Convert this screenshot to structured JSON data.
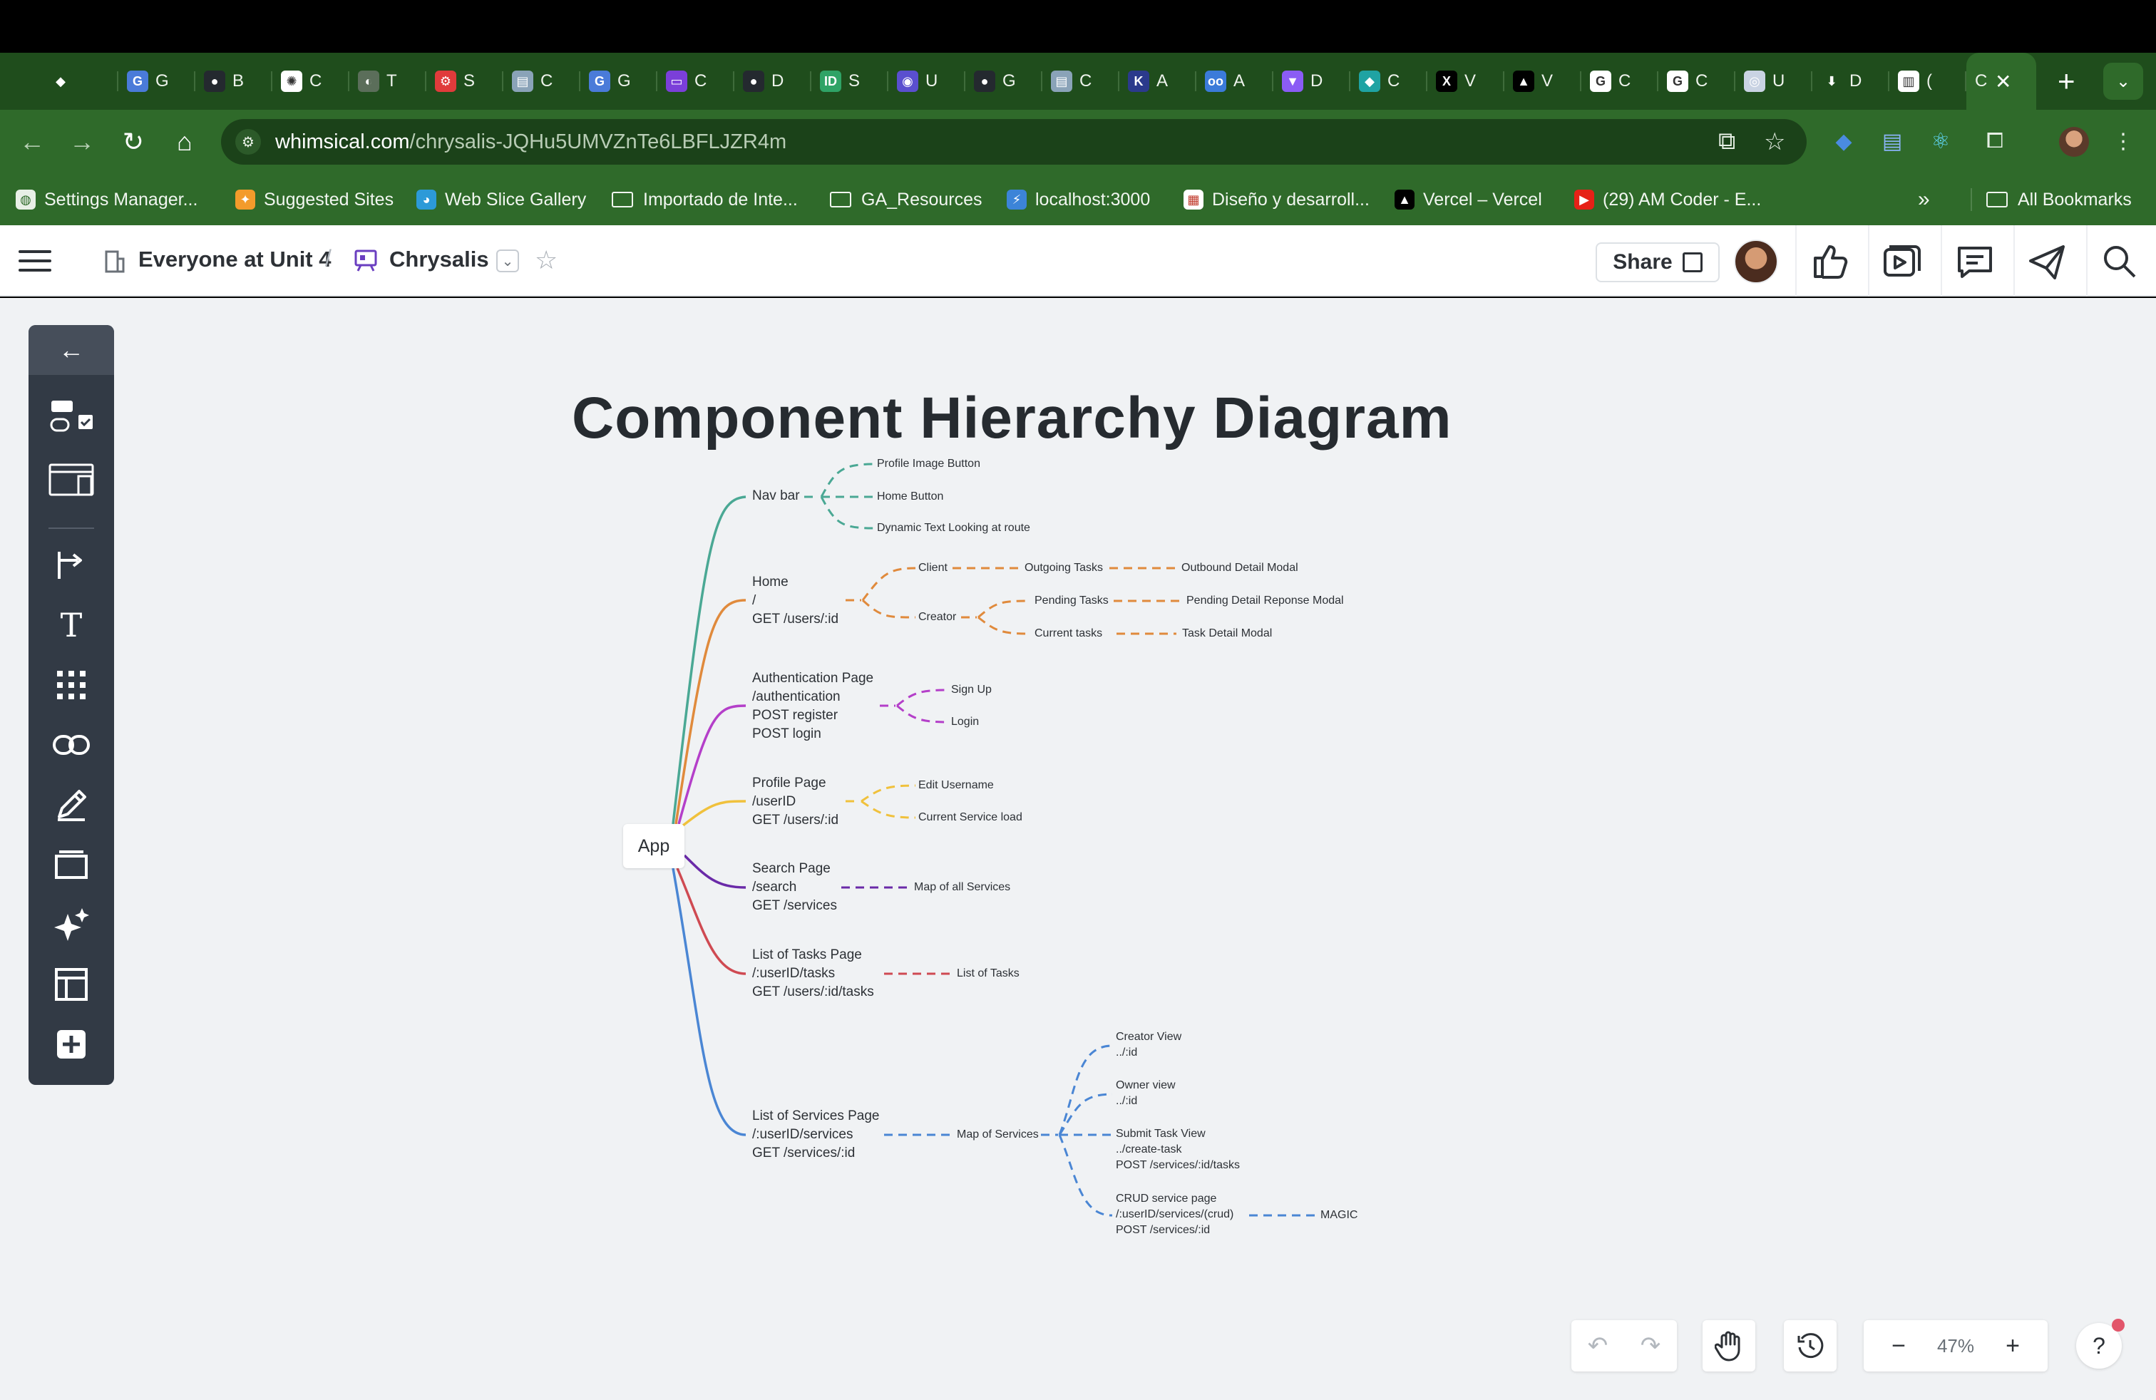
{
  "browser": {
    "tabs": [
      {
        "title": "",
        "fav_color": "#1f4d1c",
        "fav_glyph": "◆"
      },
      {
        "title": "G",
        "fav_color": "#4a7bd9",
        "fav_glyph": "G"
      },
      {
        "title": "B",
        "fav_color": "#24292f",
        "fav_glyph": "●"
      },
      {
        "title": "C",
        "fav_color": "#ffffff",
        "fav_glyph": "✺"
      },
      {
        "title": "T",
        "fav_color": "#5b6e5a",
        "fav_glyph": "◐"
      },
      {
        "title": "S",
        "fav_color": "#e03b3b",
        "fav_glyph": "⚙"
      },
      {
        "title": "C",
        "fav_color": "#8aa3b8",
        "fav_glyph": "▤"
      },
      {
        "title": "G",
        "fav_color": "#4a7bd9",
        "fav_glyph": "G"
      },
      {
        "title": "C",
        "fav_color": "#7b3fd9",
        "fav_glyph": "▭"
      },
      {
        "title": "D",
        "fav_color": "#24292f",
        "fav_glyph": "●"
      },
      {
        "title": "S",
        "fav_color": "#2fa366",
        "fav_glyph": "ID"
      },
      {
        "title": "U",
        "fav_color": "#5a4fcf",
        "fav_glyph": "◉"
      },
      {
        "title": "G",
        "fav_color": "#24292f",
        "fav_glyph": "●"
      },
      {
        "title": "C",
        "fav_color": "#8aa3b8",
        "fav_glyph": "▤"
      },
      {
        "title": "A",
        "fav_color": "#2b3a8c",
        "fav_glyph": "K"
      },
      {
        "title": "A",
        "fav_color": "#3b7bd9",
        "fav_glyph": "oo"
      },
      {
        "title": "D",
        "fav_color": "#8a5cf5",
        "fav_glyph": "▼"
      },
      {
        "title": "C",
        "fav_color": "#1fa3a3",
        "fav_glyph": "◆"
      },
      {
        "title": "V",
        "fav_color": "#000000",
        "fav_glyph": "X"
      },
      {
        "title": "V",
        "fav_color": "#000000",
        "fav_glyph": "▲"
      },
      {
        "title": "C",
        "fav_color": "#ffffff",
        "fav_glyph": "G"
      },
      {
        "title": "C",
        "fav_color": "#ffffff",
        "fav_glyph": "G"
      },
      {
        "title": "U",
        "fav_color": "#c9d3e3",
        "fav_glyph": "◎"
      },
      {
        "title": "D",
        "fav_color": "#1f4d1c",
        "fav_glyph": "⬇"
      },
      {
        "title": "(",
        "fav_color": "#ffffff",
        "fav_glyph": "▥"
      }
    ],
    "active_tab_title": "C",
    "address": {
      "host": "whimsical.com",
      "path": "/chrysalis-JQHu5UMVZnTe6LBFLJZR4m"
    },
    "bookmarks": [
      {
        "label": "Settings Manager...",
        "icon": "globe-icon"
      },
      {
        "label": "Suggested Sites",
        "icon": "bulb-icon"
      },
      {
        "label": "Web Slice Gallery",
        "icon": "edge-icon"
      },
      {
        "label": "Importado de Inte...",
        "icon": "folder-icon"
      },
      {
        "label": "GA_Resources",
        "icon": "folder-icon"
      },
      {
        "label": "localhost:3000",
        "icon": "lightning-icon"
      },
      {
        "label": "Diseño y desarroll...",
        "icon": "site-icon"
      },
      {
        "label": "Vercel – Vercel",
        "icon": "vercel-icon"
      },
      {
        "label": "(29) AM Coder - E...",
        "icon": "youtube-icon"
      }
    ],
    "overflow_label": "»",
    "all_bookmarks_label": "All Bookmarks"
  },
  "app_header": {
    "workspace": "Everyone at Unit 4",
    "separator": "/",
    "board": "Chrysalis",
    "share_label": "Share"
  },
  "diagram": {
    "title": "Component Hierarchy Diagram",
    "root": "App",
    "colors": {
      "nav": "#4aa894",
      "home": "#e08a3c",
      "auth": "#b43fc9",
      "profile": "#f0c13c",
      "search": "#6a2aa8",
      "tasks": "#cf4a52",
      "services": "#4a86d4"
    },
    "pages": [
      {
        "id": "nav",
        "label": "Nav bar"
      },
      {
        "id": "home",
        "label": "Home\n/\nGET /users/:id"
      },
      {
        "id": "auth",
        "label": "Authentication Page\n/authentication\nPOST register\nPOST login"
      },
      {
        "id": "profile",
        "label": "Profile Page\n/userID\nGET /users/:id"
      },
      {
        "id": "search",
        "label": "Search Page\n/search\nGET /services"
      },
      {
        "id": "tasks",
        "label": "List of Tasks Page\n/:userID/tasks\nGET /users/:id/tasks"
      },
      {
        "id": "services",
        "label": "List of Services Page\n/:userID/services\nGET /services/:id"
      }
    ],
    "children": {
      "nav_profile_btn": "Profile Image Button",
      "nav_home_btn": "Home Button",
      "nav_dynamic": "Dynamic Text Looking at route",
      "home_client": "Client",
      "home_creator": "Creator",
      "home_outgoing": "Outgoing Tasks",
      "home_outbound_modal": "Outbound Detail Modal",
      "home_pending": "Pending Tasks",
      "home_pending_modal": "Pending Detail Reponse Modal",
      "home_current": "Current tasks",
      "home_task_modal": "Task Detail Modal",
      "auth_signup": "Sign Up",
      "auth_login": "Login",
      "profile_edit": "Edit Username",
      "profile_load": "Current Service load",
      "search_map": "Map of all Services",
      "tasks_list": "List of Tasks",
      "services_map": "Map of Services",
      "services_creator": "Creator View\n../:id",
      "services_owner": "Owner view\n../:id",
      "services_submit": "Submit Task View\n../create-task\nPOST /services/:id/tasks",
      "services_crud": "CRUD service page\n/:userID/services/(crud)\nPOST /services/:id",
      "services_magic": "MAGIC"
    }
  },
  "bottom_controls": {
    "zoom_out_label": "−",
    "zoom_value": "47%",
    "zoom_in_label": "+",
    "help_label": "?"
  }
}
